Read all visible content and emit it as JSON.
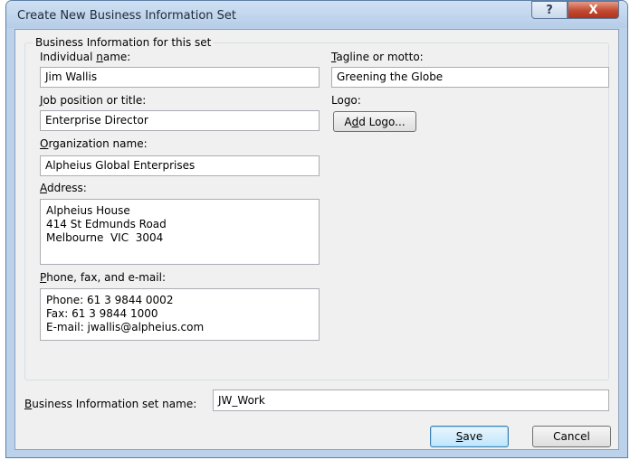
{
  "window": {
    "title": "Create New Business Information Set",
    "help_glyph": "?",
    "close_glyph": "X"
  },
  "group": {
    "label": "Business Information for this set"
  },
  "fields": {
    "individual_name": {
      "label_pre": "Individual ",
      "label_key": "n",
      "label_post": "ame:",
      "value": "Jim Wallis"
    },
    "job_title": {
      "label_pre": "",
      "label_key": "J",
      "label_post": "ob position or title:",
      "value": "Enterprise Director"
    },
    "organization": {
      "label_pre": "",
      "label_key": "O",
      "label_post": "rganization name:",
      "value": "Alpheius Global Enterprises"
    },
    "address": {
      "label_pre": "",
      "label_key": "A",
      "label_post": "ddress:",
      "value": "Alpheius House\n414 St Edmunds Road\nMelbourne  VIC  3004"
    },
    "contact": {
      "label_pre": "",
      "label_key": "P",
      "label_post": "hone, fax, and e-mail:",
      "value": "Phone: 61 3 9844 0002\nFax: 61 3 9844 1000\nE-mail: jwallis@alpheius.com"
    },
    "tagline": {
      "label_pre": "",
      "label_key": "T",
      "label_post": "agline or motto:",
      "value": "Greening the Globe"
    },
    "logo": {
      "label": "Logo:",
      "button_pre": "A",
      "button_key": "d",
      "button_post": "d Logo..."
    },
    "set_name": {
      "label_pre": "",
      "label_key": "B",
      "label_post": "usiness Information set name:",
      "value": "JW_Work"
    }
  },
  "buttons": {
    "save_key": "S",
    "save_post": "ave",
    "cancel": "Cancel"
  }
}
